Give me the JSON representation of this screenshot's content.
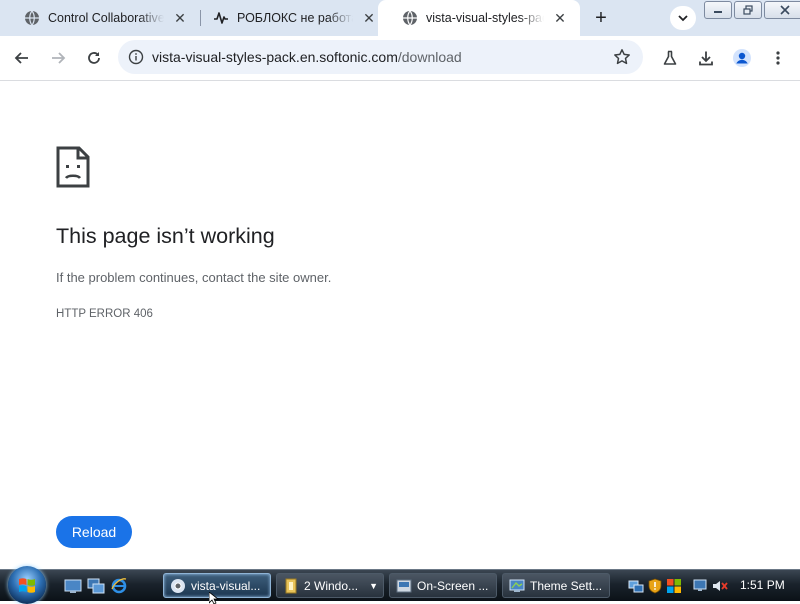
{
  "browser": {
    "tabs": [
      {
        "title": "Control Collaborative V",
        "favicon": "globe-icon",
        "active": false
      },
      {
        "title": "РОБЛОКС не работает",
        "favicon": "pulse-icon",
        "active": false
      },
      {
        "title": "vista-visual-styles-pack",
        "favicon": "globe-icon",
        "active": true
      }
    ],
    "tab_close_glyph": "✕",
    "new_tab_glyph": "+",
    "url_host": "vista-visual-styles-pack.en.softonic.com",
    "url_path": "/download",
    "toolbar_icons": [
      "back-icon",
      "forward-icon",
      "reload-icon",
      "site-info-icon",
      "bookmark-star-icon",
      "labs-flask-icon",
      "download-icon",
      "profile-icon",
      "menu-icon"
    ]
  },
  "error_page": {
    "title": "This page isn’t working",
    "message": "If the problem continues, contact the site owner.",
    "code": "HTTP ERROR 406",
    "reload_label": "Reload"
  },
  "taskbar": {
    "tasks": [
      {
        "label": "vista-visual...",
        "icon": "chrome-icon",
        "active": true
      },
      {
        "label": "2 Windo...",
        "icon": "folder-icon",
        "active": false,
        "group_arrow": "▼"
      },
      {
        "label": "On-Screen ...",
        "icon": "keyboard-icon",
        "active": false
      },
      {
        "label": "Theme Sett...",
        "icon": "theme-icon",
        "active": false
      }
    ],
    "clock": "1:51 PM"
  },
  "colors": {
    "accent": "#1a73e8",
    "tabstrip": "#dbe5f2",
    "omnibox": "#edf2fa",
    "text_primary": "#202124",
    "text_secondary": "#5f6368"
  }
}
